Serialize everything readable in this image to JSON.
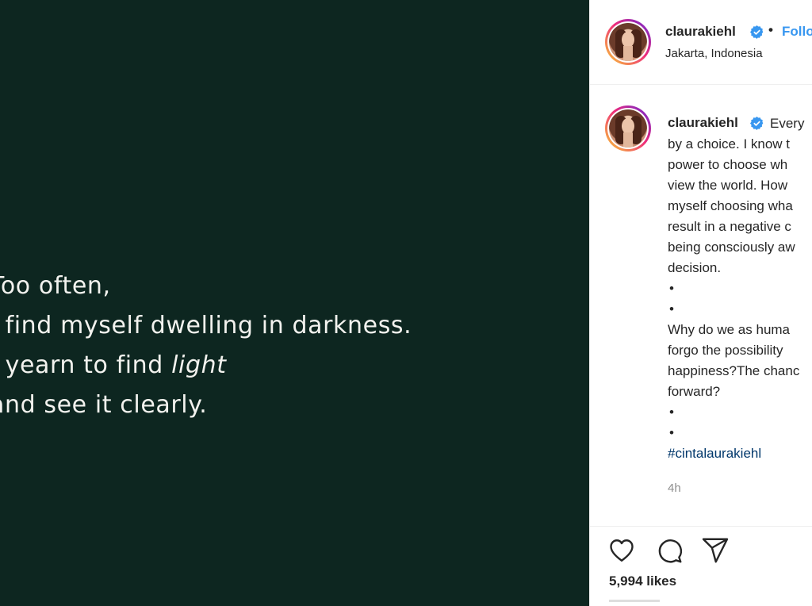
{
  "post_image": {
    "background": "#0d2620",
    "quote_lines": [
      {
        "text": "Too often,",
        "italic_suffix": ""
      },
      {
        "text": "I find myself dwelling in darkness.",
        "italic_suffix": ""
      },
      {
        "text": "I yearn to find ",
        "italic_suffix": "light"
      },
      {
        "text": "and see it clearly.",
        "italic_suffix": ""
      }
    ]
  },
  "header": {
    "username": "claurakiehl",
    "separator": "•",
    "follow_label": "Follow",
    "location": "Jakarta, Indonesia",
    "verified_icon": "verified-badge-icon",
    "accent_color": "#3897f0"
  },
  "caption": {
    "username": "claurakiehl",
    "lines": [
      "Every",
      "by a choice. I know t",
      "power to choose wh",
      "view the world. How",
      "myself choosing wha",
      "result in a negative c",
      "being consciously aw",
      "decision.",
      "•",
      "•",
      "Why do we as huma",
      "forgo the possibility",
      "happiness?The chanc",
      "forward?",
      "•",
      "•"
    ],
    "hashtag": "#cintalaurakiehl",
    "timestamp": "4h"
  },
  "actions": {
    "like_icon": "heart-icon",
    "comment_icon": "comment-icon",
    "share_icon": "paper-plane-icon",
    "likes_count": "5,994",
    "likes_label": "likes"
  }
}
